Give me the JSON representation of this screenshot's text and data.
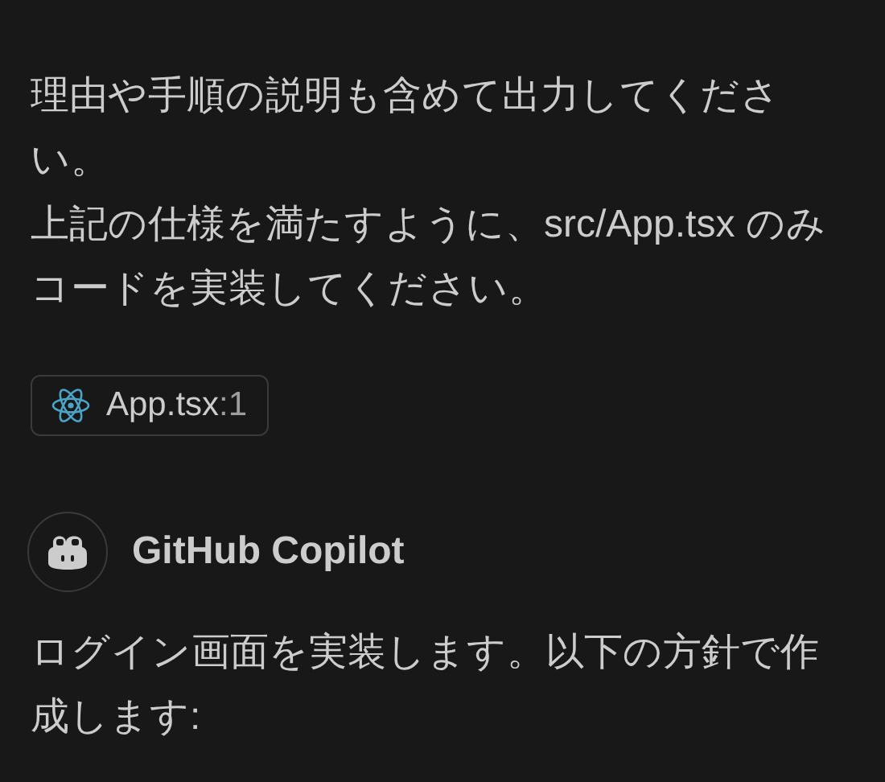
{
  "user_message": {
    "paragraphs": [
      {
        "lines": [
          "理由や手順の説明も含めて出力してくださ",
          "い。"
        ]
      },
      {
        "lines": [
          "上記の仕様を満たすように、src/App.tsx のみ",
          "コードを実装してください。"
        ]
      }
    ],
    "attachment": {
      "name": "App.tsx",
      "line": ":1"
    }
  },
  "assistant": {
    "name": "GitHub Copilot",
    "lines": [
      "ログイン画面を実装します。以下の方針で作",
      "成します:"
    ]
  }
}
